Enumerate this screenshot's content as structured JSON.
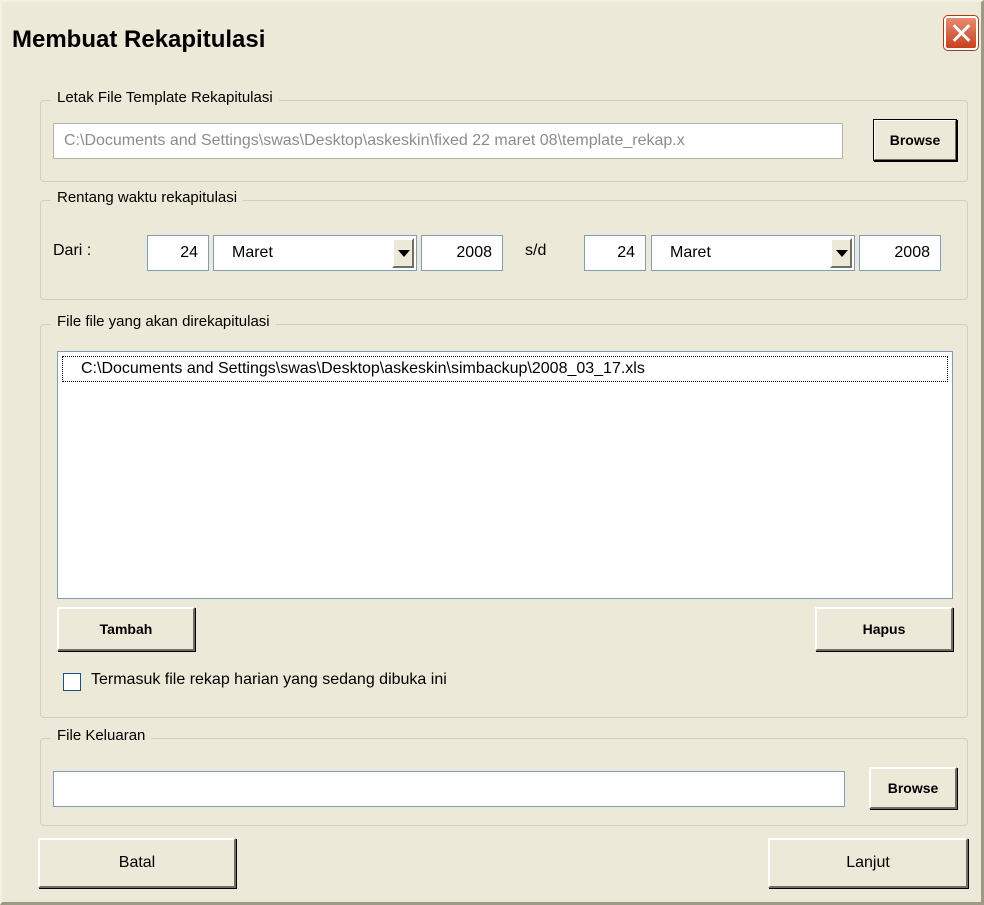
{
  "window": {
    "title": "Membuat Rekapitulasi"
  },
  "template_group": {
    "legend": "Letak File Template Rekapitulasi",
    "path_value": "C:\\Documents and Settings\\swas\\Desktop\\askeskin\\fixed 22 maret 08\\template_rekap.x",
    "browse_label": "Browse"
  },
  "range_group": {
    "legend": "Rentang waktu rekapitulasi",
    "from_label": "Dari :",
    "from_day": "24",
    "from_month": "Maret",
    "from_year": "2008",
    "separator": "s/d",
    "to_day": "24",
    "to_month": "Maret",
    "to_year": "2008"
  },
  "files_group": {
    "legend": "File file yang akan direkapitulasi",
    "items": [
      "C:\\Documents and Settings\\swas\\Desktop\\askeskin\\simbackup\\2008_03_17.xls"
    ],
    "add_label": "Tambah",
    "remove_label": "Hapus",
    "checkbox_label": "Termasuk file rekap harian yang sedang dibuka ini",
    "checkbox_checked": false
  },
  "output_group": {
    "legend": "File Keluaran",
    "path_value": "",
    "browse_label": "Browse"
  },
  "footer": {
    "cancel_label": "Batal",
    "next_label": "Lanjut"
  }
}
